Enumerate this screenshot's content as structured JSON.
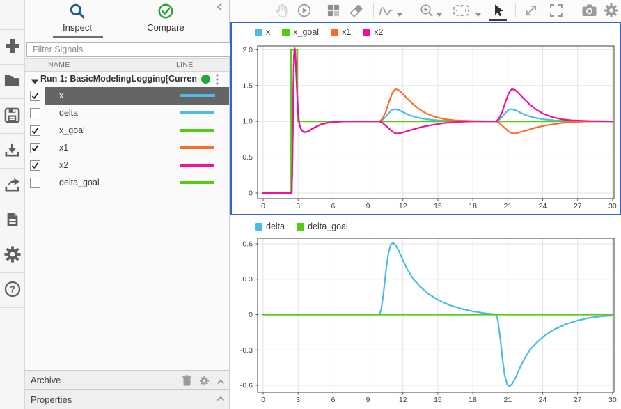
{
  "colors": {
    "selection_border": "#2d63e0",
    "selected_row_bg": "#656565",
    "run_dot": "#23a73c",
    "inspect_icon": "#1f5d82",
    "compare_icon": "#2aa13c",
    "signal_blue": "#4cbbe8",
    "signal_green": "#55cb13",
    "signal_orange": "#fd6c2a",
    "signal_magenta": "#f2109c"
  },
  "sidebar": {
    "icons": [
      "plus-icon",
      "folder-open-icon",
      "save-icon",
      "import-icon",
      "export-icon",
      "report-icon",
      "preferences-gear-icon",
      "help-icon"
    ]
  },
  "tabs": {
    "inspect": "Inspect",
    "compare": "Compare"
  },
  "filter": {
    "placeholder": "Filter Signals"
  },
  "table": {
    "columns": [
      "NAME",
      "LINE"
    ]
  },
  "run": {
    "label": "Run 1: BasicModelingLogging[Curren"
  },
  "signals": [
    {
      "name": "x",
      "checked": true,
      "selected": true,
      "color": "#4cbbe8"
    },
    {
      "name": "delta",
      "checked": false,
      "selected": false,
      "color": "#4cbbe8"
    },
    {
      "name": "x_goal",
      "checked": true,
      "selected": false,
      "color": "#55cb13"
    },
    {
      "name": "x1",
      "checked": true,
      "selected": false,
      "color": "#fd6c2a"
    },
    {
      "name": "x2",
      "checked": true,
      "selected": false,
      "color": "#f2109c"
    },
    {
      "name": "delta_goal",
      "checked": false,
      "selected": false,
      "color": "#55cb13"
    }
  ],
  "panels": {
    "archive": "Archive",
    "properties": "Properties"
  },
  "toolbar": {
    "icons": [
      "pan-hand-icon",
      "replay-icon",
      "layout-grid-icon",
      "eraser-icon",
      "signal-wave-icon",
      "zoom-in-icon",
      "fit-to-view-icon",
      "pointer-cursor-icon",
      "expand-icon",
      "fullscreen-icon",
      "snapshot-camera-icon",
      "settings-gear-icon"
    ]
  },
  "chart_data": [
    {
      "type": "line",
      "title": "",
      "xlabel": "",
      "ylabel": "",
      "xlim": [
        -0.45,
        30.3
      ],
      "ylim": [
        -0.08,
        2.05
      ],
      "xticks": [
        0,
        3,
        6,
        9,
        12,
        15,
        18,
        21,
        24,
        27,
        30
      ],
      "yticks": [
        0,
        0.5,
        1.0,
        1.5,
        2.0
      ],
      "ytick_labels": [
        "0",
        "0.5",
        "1.0",
        "1.5",
        "2.0"
      ],
      "grid": true,
      "legend_position": "top-left",
      "series": [
        {
          "name": "x",
          "color": "#4cbbe8",
          "points": [
            [
              0,
              0
            ],
            [
              2.45,
              0
            ],
            [
              2.5,
              0.3
            ],
            [
              2.55,
              0.9
            ],
            [
              2.6,
              1.55
            ],
            [
              2.65,
              1.92
            ],
            [
              2.7,
              2.02
            ],
            [
              2.75,
              1.98
            ],
            [
              2.8,
              1.82
            ],
            [
              2.9,
              1.45
            ],
            [
              3.0,
              1.12
            ],
            [
              3.1,
              0.97
            ],
            [
              3.25,
              0.89
            ],
            [
              3.45,
              0.855
            ],
            [
              3.65,
              0.85
            ],
            [
              3.9,
              0.865
            ],
            [
              4.2,
              0.895
            ],
            [
              4.6,
              0.93
            ],
            [
              5.0,
              0.96
            ],
            [
              5.5,
              0.98
            ],
            [
              6.0,
              0.99
            ],
            [
              7,
              1.0
            ],
            [
              10,
              1.0
            ],
            [
              10.2,
              1.015
            ],
            [
              10.5,
              1.06
            ],
            [
              10.8,
              1.12
            ],
            [
              11.1,
              1.165
            ],
            [
              11.35,
              1.17
            ],
            [
              11.7,
              1.155
            ],
            [
              12.1,
              1.12
            ],
            [
              12.6,
              1.085
            ],
            [
              13.2,
              1.055
            ],
            [
              14,
              1.03
            ],
            [
              15,
              1.015
            ],
            [
              16,
              1.005
            ],
            [
              17.5,
              1.0
            ],
            [
              20,
              1.0
            ],
            [
              20.2,
              1.015
            ],
            [
              20.5,
              1.06
            ],
            [
              20.8,
              1.12
            ],
            [
              21.1,
              1.165
            ],
            [
              21.35,
              1.17
            ],
            [
              21.7,
              1.155
            ],
            [
              22.1,
              1.12
            ],
            [
              22.6,
              1.085
            ],
            [
              23.2,
              1.055
            ],
            [
              24,
              1.03
            ],
            [
              25,
              1.015
            ],
            [
              26,
              1.005
            ],
            [
              27.5,
              1.0
            ],
            [
              30,
              1.0
            ]
          ]
        },
        {
          "name": "x_goal",
          "color": "#55cb13",
          "points": [
            [
              0,
              0
            ],
            [
              2.4,
              0
            ],
            [
              2.4,
              2
            ],
            [
              2.93,
              2
            ],
            [
              2.93,
              1
            ],
            [
              30,
              1
            ]
          ]
        },
        {
          "name": "x1",
          "color": "#fd6c2a",
          "points": [
            [
              0,
              0
            ],
            [
              2.45,
              0
            ],
            [
              2.5,
              0.3
            ],
            [
              2.55,
              0.9
            ],
            [
              2.6,
              1.55
            ],
            [
              2.65,
              1.92
            ],
            [
              2.7,
              2.02
            ],
            [
              2.75,
              1.98
            ],
            [
              2.8,
              1.82
            ],
            [
              2.9,
              1.45
            ],
            [
              3.0,
              1.12
            ],
            [
              3.1,
              0.97
            ],
            [
              3.25,
              0.89
            ],
            [
              3.45,
              0.855
            ],
            [
              3.65,
              0.85
            ],
            [
              3.9,
              0.865
            ],
            [
              4.2,
              0.895
            ],
            [
              4.6,
              0.93
            ],
            [
              5.0,
              0.96
            ],
            [
              5.5,
              0.98
            ],
            [
              6.0,
              0.99
            ],
            [
              7,
              1.0
            ],
            [
              10,
              1.0
            ],
            [
              10.2,
              1.03
            ],
            [
              10.5,
              1.12
            ],
            [
              10.8,
              1.27
            ],
            [
              11.1,
              1.4
            ],
            [
              11.35,
              1.45
            ],
            [
              11.6,
              1.44
            ],
            [
              11.9,
              1.4
            ],
            [
              12.3,
              1.33
            ],
            [
              12.8,
              1.25
            ],
            [
              13.4,
              1.17
            ],
            [
              14,
              1.11
            ],
            [
              14.8,
              1.06
            ],
            [
              15.6,
              1.03
            ],
            [
              16.5,
              1.015
            ],
            [
              18,
              1.005
            ],
            [
              20,
              1.0
            ],
            [
              20.2,
              0.985
            ],
            [
              20.5,
              0.945
            ],
            [
              20.9,
              0.885
            ],
            [
              21.2,
              0.845
            ],
            [
              21.5,
              0.83
            ],
            [
              21.9,
              0.84
            ],
            [
              22.4,
              0.865
            ],
            [
              23,
              0.895
            ],
            [
              23.7,
              0.925
            ],
            [
              24.5,
              0.95
            ],
            [
              25.5,
              0.975
            ],
            [
              26.5,
              0.99
            ],
            [
              28,
              1.0
            ],
            [
              30,
              1.0
            ]
          ]
        },
        {
          "name": "x2",
          "color": "#f2109c",
          "points": [
            [
              0,
              0
            ],
            [
              2.45,
              0
            ],
            [
              2.5,
              0.3
            ],
            [
              2.55,
              0.9
            ],
            [
              2.6,
              1.55
            ],
            [
              2.65,
              1.92
            ],
            [
              2.7,
              2.02
            ],
            [
              2.75,
              1.98
            ],
            [
              2.8,
              1.82
            ],
            [
              2.9,
              1.45
            ],
            [
              3.0,
              1.12
            ],
            [
              3.1,
              0.97
            ],
            [
              3.25,
              0.89
            ],
            [
              3.45,
              0.855
            ],
            [
              3.65,
              0.85
            ],
            [
              3.9,
              0.865
            ],
            [
              4.2,
              0.895
            ],
            [
              4.6,
              0.93
            ],
            [
              5.0,
              0.96
            ],
            [
              5.5,
              0.98
            ],
            [
              6.0,
              0.99
            ],
            [
              7,
              1.0
            ],
            [
              10,
              1.0
            ],
            [
              10.2,
              0.985
            ],
            [
              10.5,
              0.945
            ],
            [
              10.9,
              0.885
            ],
            [
              11.2,
              0.845
            ],
            [
              11.5,
              0.83
            ],
            [
              11.9,
              0.84
            ],
            [
              12.4,
              0.865
            ],
            [
              13,
              0.895
            ],
            [
              13.7,
              0.925
            ],
            [
              14.5,
              0.95
            ],
            [
              15.5,
              0.975
            ],
            [
              16.5,
              0.99
            ],
            [
              18,
              1.0
            ],
            [
              20,
              1.0
            ],
            [
              20.2,
              1.03
            ],
            [
              20.5,
              1.12
            ],
            [
              20.8,
              1.27
            ],
            [
              21.1,
              1.4
            ],
            [
              21.35,
              1.45
            ],
            [
              21.6,
              1.44
            ],
            [
              21.9,
              1.4
            ],
            [
              22.3,
              1.33
            ],
            [
              22.8,
              1.25
            ],
            [
              23.4,
              1.17
            ],
            [
              24,
              1.11
            ],
            [
              24.8,
              1.06
            ],
            [
              25.6,
              1.03
            ],
            [
              26.5,
              1.015
            ],
            [
              28,
              1.005
            ],
            [
              30,
              1.0
            ]
          ]
        }
      ]
    },
    {
      "type": "line",
      "title": "",
      "xlabel": "",
      "ylabel": "",
      "xlim": [
        -0.45,
        30.3
      ],
      "ylim": [
        -0.66,
        0.65
      ],
      "xticks": [
        0,
        3,
        6,
        9,
        12,
        15,
        18,
        21,
        24,
        27,
        30
      ],
      "yticks": [
        -0.6,
        -0.3,
        0,
        0.3,
        0.6
      ],
      "ytick_labels": [
        "-0.6",
        "-0.3",
        "0",
        "0.3",
        "0.6"
      ],
      "grid": true,
      "legend_position": "top-left",
      "series": [
        {
          "name": "delta",
          "color": "#4cbbe8",
          "points": [
            [
              0,
              0
            ],
            [
              10,
              0
            ],
            [
              10.15,
              0.05
            ],
            [
              10.35,
              0.2
            ],
            [
              10.55,
              0.38
            ],
            [
              10.75,
              0.52
            ],
            [
              10.95,
              0.59
            ],
            [
              11.15,
              0.61
            ],
            [
              11.4,
              0.585
            ],
            [
              11.7,
              0.53
            ],
            [
              12,
              0.46
            ],
            [
              12.4,
              0.38
            ],
            [
              12.9,
              0.3
            ],
            [
              13.5,
              0.235
            ],
            [
              14.2,
              0.175
            ],
            [
              15,
              0.125
            ],
            [
              16,
              0.08
            ],
            [
              17,
              0.05
            ],
            [
              18,
              0.028
            ],
            [
              19,
              0.012
            ],
            [
              19.8,
              0.004
            ],
            [
              20,
              0
            ],
            [
              20.15,
              -0.05
            ],
            [
              20.35,
              -0.2
            ],
            [
              20.55,
              -0.38
            ],
            [
              20.75,
              -0.52
            ],
            [
              20.95,
              -0.59
            ],
            [
              21.15,
              -0.61
            ],
            [
              21.4,
              -0.585
            ],
            [
              21.7,
              -0.53
            ],
            [
              22,
              -0.46
            ],
            [
              22.4,
              -0.38
            ],
            [
              22.9,
              -0.3
            ],
            [
              23.5,
              -0.235
            ],
            [
              24.2,
              -0.175
            ],
            [
              25,
              -0.125
            ],
            [
              26,
              -0.08
            ],
            [
              27,
              -0.05
            ],
            [
              28,
              -0.028
            ],
            [
              29,
              -0.015
            ],
            [
              30,
              -0.008
            ]
          ]
        },
        {
          "name": "delta_goal",
          "color": "#55cb13",
          "points": [
            [
              0,
              0
            ],
            [
              30,
              0
            ]
          ]
        }
      ]
    }
  ]
}
